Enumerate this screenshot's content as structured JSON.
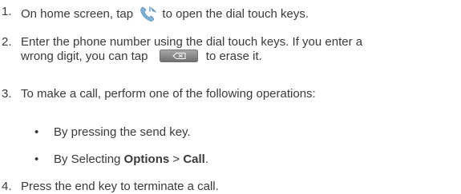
{
  "steps": [
    {
      "num": "1.",
      "before_icon": "On home screen, tap",
      "icon": "dialer-phone-icon",
      "after_icon": "to open the dial touch keys."
    },
    {
      "num": "2.",
      "line1": "Enter the phone number using the dial touch keys. If you enter a",
      "before_icon": "wrong digit, you can tap",
      "icon": "backspace-erase-icon",
      "after_icon": "to erase it."
    },
    {
      "num": "3.",
      "text": "To make a call, perform one of the following operations:",
      "bullets": [
        {
          "dot": "•",
          "text": "By pressing the send key."
        },
        {
          "dot": "•",
          "pre": "By Selecting ",
          "bold1": "Options",
          "mid": " > ",
          "bold2": "Call",
          "post": "."
        }
      ]
    },
    {
      "num": "4.",
      "text": "Press the end key to terminate a call."
    }
  ],
  "colors": {
    "text": "#3a3a3a",
    "phone_icon": "#7fb2d6",
    "erase_button": "#8a8a8a"
  }
}
